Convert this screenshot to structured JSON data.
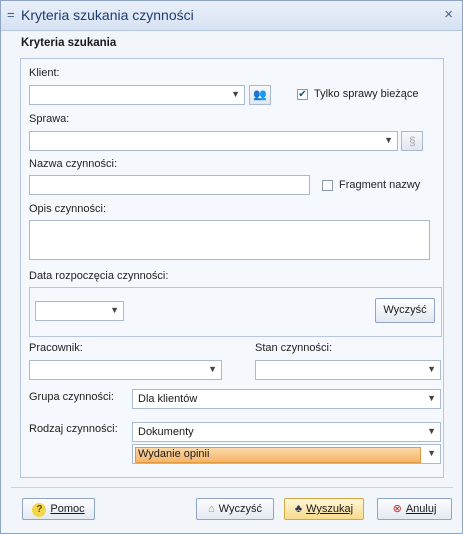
{
  "window": {
    "title": "Kryteria szukania czynności",
    "grip_icon": "=",
    "close_icon": "×"
  },
  "section_title": "Kryteria szukania",
  "klient": {
    "label": "Klient:",
    "value": ""
  },
  "tylko": {
    "label": "Tylko sprawy bieżące",
    "checked": true,
    "mark": "✔"
  },
  "sprawa": {
    "label": "Sprawa:",
    "value": ""
  },
  "nazwa": {
    "label": "Nazwa czynności:",
    "value": ""
  },
  "fragment": {
    "label": "Fragment nazwy",
    "checked": false
  },
  "opis": {
    "label": "Opis czynności:",
    "value": ""
  },
  "data": {
    "label": "Data rozpoczęcia czynności:",
    "value": "",
    "clear_label": "Wyczyść"
  },
  "pracownik": {
    "label": "Pracownik:",
    "value": ""
  },
  "stan": {
    "label": "Stan czynności:",
    "value": ""
  },
  "grupa": {
    "label": "Grupa czynności:",
    "value": "Dla klientów"
  },
  "rodzaj": {
    "label": "Rodzaj czynności:",
    "value1": "Dokumenty",
    "value2": "Wydanie opinii"
  },
  "buttons": {
    "pomoc": "Pomoc",
    "wyczysc": "Wyczyść",
    "wyszukaj": "Wyszukaj",
    "anuluj": "Anuluj"
  },
  "icons": {
    "help": "?",
    "broom": "⌂",
    "binoculars": "♣",
    "cancel": "⊗",
    "people": "👥",
    "dollar": "§"
  }
}
